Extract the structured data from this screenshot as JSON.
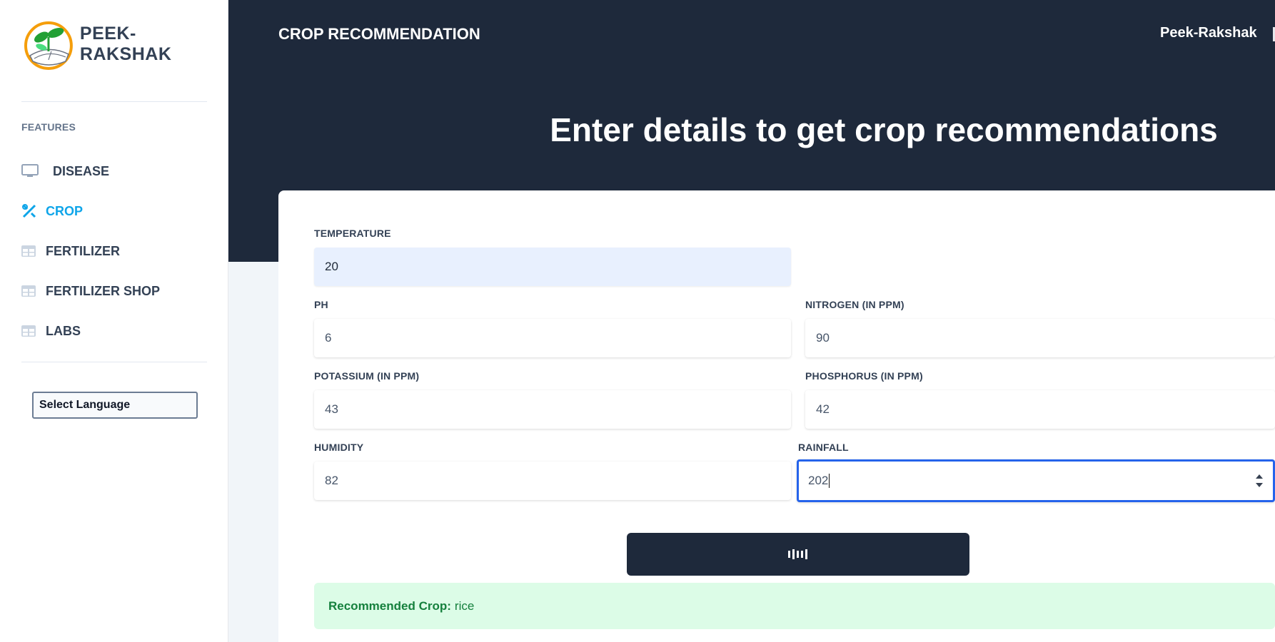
{
  "brand": {
    "name": "PEEK-RAKSHAK",
    "logo_icon": "sprout-logo-icon"
  },
  "sidebar": {
    "section_title": "FEATURES",
    "items": [
      {
        "label": "DISEASE",
        "icon": "monitor-icon",
        "active": false
      },
      {
        "label": "CROP",
        "icon": "tools-icon",
        "active": true
      },
      {
        "label": "FERTILIZER",
        "icon": "table-icon",
        "active": false
      },
      {
        "label": "FERTILIZER SHOP",
        "icon": "table-icon",
        "active": false
      },
      {
        "label": "LABS",
        "icon": "table-icon",
        "active": false
      }
    ],
    "language_select": {
      "value": "Select Language"
    }
  },
  "header": {
    "title": "CROP RECOMMENDATION",
    "user": "Peek-Rakshak"
  },
  "hero": {
    "heading": "Enter details to get crop recommendations"
  },
  "form": {
    "temperature": {
      "label": "TEMPERATURE",
      "value": "20"
    },
    "ph": {
      "label": "PH",
      "value": "6"
    },
    "nitrogen": {
      "label": "NITROGEN (IN PPM)",
      "value": "90"
    },
    "potassium": {
      "label": "POTASSIUM (IN PPM)",
      "value": "43"
    },
    "phosphorus": {
      "label": "PHOSPHORUS (IN PPM)",
      "value": "42"
    },
    "humidity": {
      "label": "HUMIDITY",
      "value": "82"
    },
    "rainfall": {
      "label": "RAINFALL",
      "value": "202"
    },
    "submit": {
      "icon": "loading-bars-icon"
    }
  },
  "result": {
    "key": "Recommended Crop:",
    "value": "rice"
  },
  "colors": {
    "dark": "#1e293b",
    "accent": "#0ea5e9",
    "success_bg": "#dcfce7",
    "success_text": "#15803d",
    "focus": "#2563eb"
  }
}
